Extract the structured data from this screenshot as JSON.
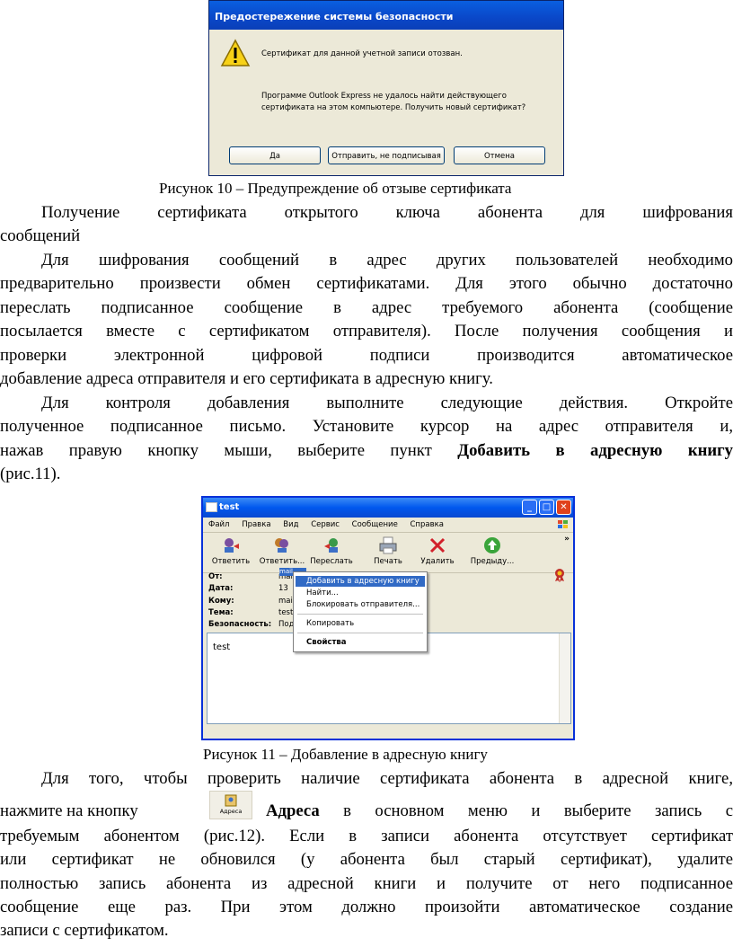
{
  "figure10": {
    "dialog_title": "Предостережение системы безопасности",
    "message_line": "Сертификат для данной учетной записи отозван.",
    "message_detail": "Программе Outlook Express не удалось найти действующего сертификата на этом компьютере. Получить новый сертификат?",
    "buttons": [
      "Да",
      "Отправить, не подписывая",
      "Отмена"
    ],
    "caption": "Рисунок 10 – Предупреждение об отзыве сертификата"
  },
  "section": {
    "heading_line1": "Получение сертификата открытого ключа абонента для шифрования",
    "heading_line2": "сообщений",
    "para1": [
      "Для шифрования сообщений в адрес других пользователей необходимо",
      "предварительно произвести обмен сертификатами. Для этого обычно достаточно",
      "переслать подписанное сообщение в адрес требуемого абонента (сообщение",
      "посылается вместе с сертификатом отправителя). После получения сообщения и",
      "проверки электронной цифровой подписи производится автоматическое",
      "добавление адреса отправителя и его сертификата в адресную книгу."
    ],
    "para2": [
      "Для контроля добавления выполните следующие действия. Откройте",
      "полученное подписанное письмо. Установите курсор на адрес отправителя и,"
    ],
    "para2_line3_pre": "нажав правую кнопку мыши, выберите пункт ",
    "para2_line3_bold": "Добавить в адресную книгу",
    "para2_line4": "(рис.11)."
  },
  "figure11": {
    "window_title": "test",
    "menu": [
      "Файл",
      "Правка",
      "Вид",
      "Сервис",
      "Сообщение",
      "Справка"
    ],
    "toolbar": [
      "Ответить",
      "Ответить...",
      "Переслать",
      "Печать",
      "Удалить",
      "Предыду..."
    ],
    "headers": {
      "from_label": "От:",
      "from_value": "mail",
      "date_label": "Дата:",
      "date_value": "13",
      "to_label": "Кому:",
      "to_value": "mail",
      "subject_label": "Тема:",
      "subject_value": "test",
      "security_label": "Безопасность:",
      "security_value": "Под"
    },
    "context_menu": [
      "Добавить в адресную книгу",
      "Найти...",
      "Блокировать отправителя...",
      "Копировать",
      "Свойства"
    ],
    "body_text": "test",
    "caption": "Рисунок 11 – Добавление в адресную книгу"
  },
  "para3": {
    "line1": "Для того, чтобы проверить наличие сертификата абонента в адресной книге,",
    "line2_pre": "нажмите на кнопку",
    "button_label": "Адреса",
    "line2_bold": "Адреса",
    "line2_post": " в основном меню и выберите запись с",
    "lines": [
      "требуемым абонентом (рис.12). Если в записи абонента отсутствует сертификат",
      "или сертификат не обновился (у абонента был старый сертификат), удалите",
      "полностью запись абонента из адресной книги и получите от него подписанное",
      "сообщение еще раз. При этом должно произойти автоматическое создание"
    ],
    "last_line": "записи с сертификатом."
  }
}
